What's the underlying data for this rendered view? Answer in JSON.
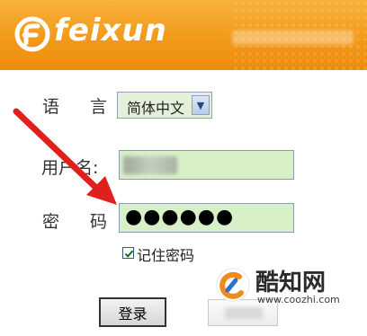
{
  "header": {
    "logo_text": "feixun",
    "logo_icon": "feixun-logo-icon",
    "accent_color": "#f29a1a"
  },
  "form": {
    "language_label": "语 言:",
    "language_value": "简体中文",
    "username_label": "用户名:",
    "password_label": "密 码:",
    "password_value": "●●●●●●",
    "remember_label": "记住密码",
    "remember_checked": true,
    "login_button_label": "登录",
    "field_color": "#d8f0c8"
  },
  "annotation": {
    "arrow_color": "#e0201c",
    "arrow_icon": "red-arrow-icon"
  },
  "watermark": {
    "title": "酷知网",
    "url": "www.coozhi.com",
    "icon": "coozhi-logo-icon"
  }
}
